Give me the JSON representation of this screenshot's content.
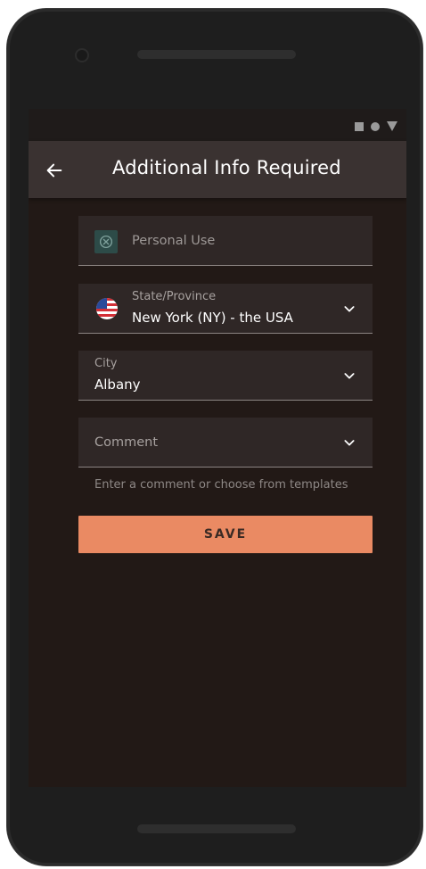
{
  "app": {
    "title": "Additional Info Required"
  },
  "form": {
    "personal_use": {
      "label": "Personal Use",
      "icon": "cancel-circle-icon"
    },
    "state": {
      "label": "State/Province",
      "value": "New York (NY) - the USA",
      "flag": "usa-flag-icon"
    },
    "city": {
      "label": "City",
      "value": "Albany"
    },
    "comment": {
      "placeholder": "Comment",
      "helper": "Enter a comment or choose from templates"
    },
    "save_label": "SAVE"
  },
  "colors": {
    "background": "#221916",
    "appbar": "#3a3231",
    "field": "#2f2726",
    "accent": "#ea8a63",
    "icon_box": "#2d4b48"
  }
}
